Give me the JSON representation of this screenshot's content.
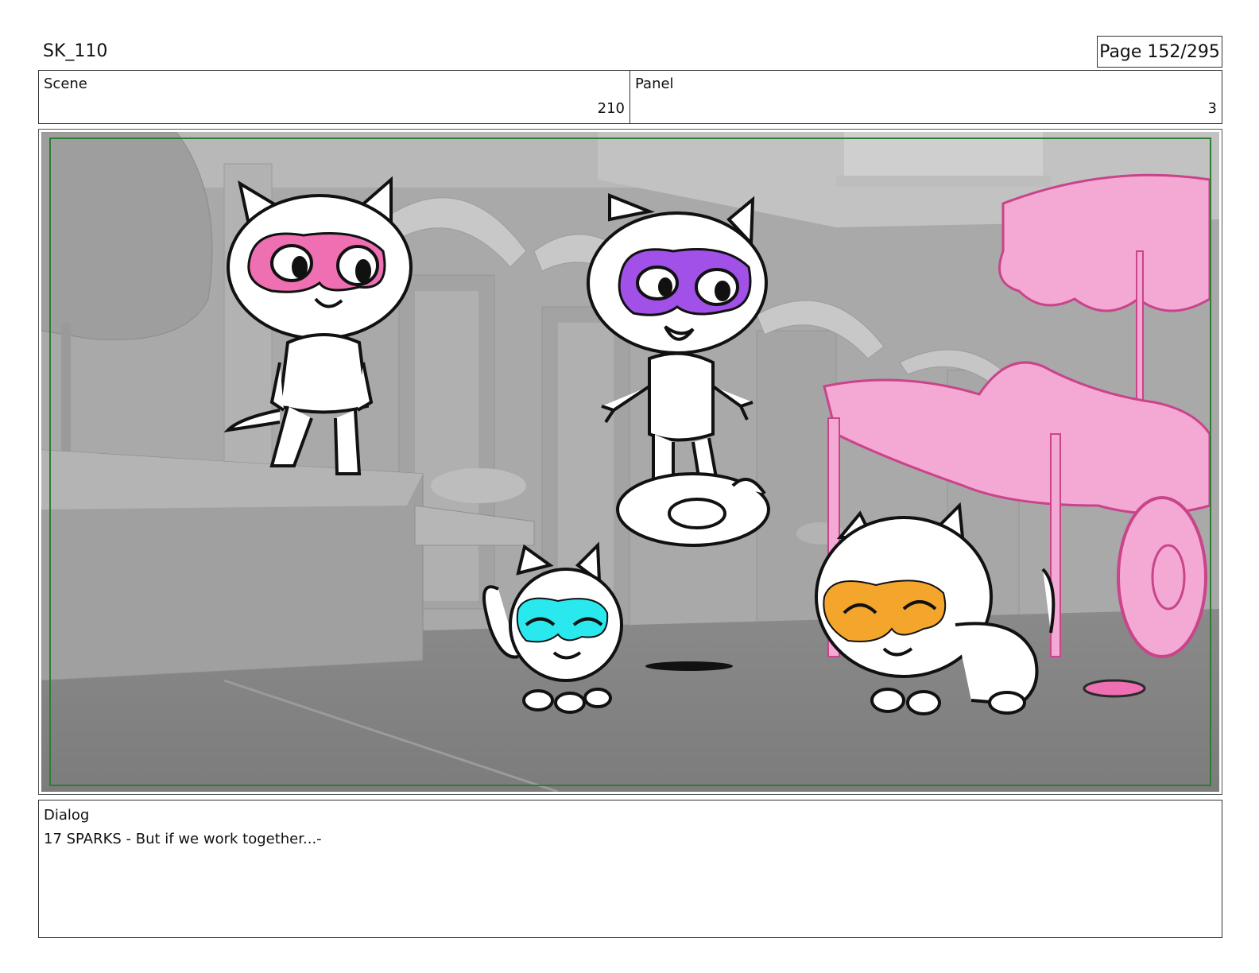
{
  "header": {
    "project": "SK_110",
    "page": "Page 152/295"
  },
  "info": {
    "scene_label": "Scene",
    "scene_value": "210",
    "panel_label": "Panel",
    "panel_value": "3"
  },
  "dialog": {
    "label": "Dialog",
    "text": "17 SPARKS - But if we work together...-"
  },
  "colors": {
    "mask_pink": "#ee6fb2",
    "mask_purple": "#a150e8",
    "mask_cyan": "#29e8ee",
    "mask_orange": "#f4a52c",
    "cart_pink": "#f4a9d4",
    "safe_frame_green": "#2e7d32"
  }
}
